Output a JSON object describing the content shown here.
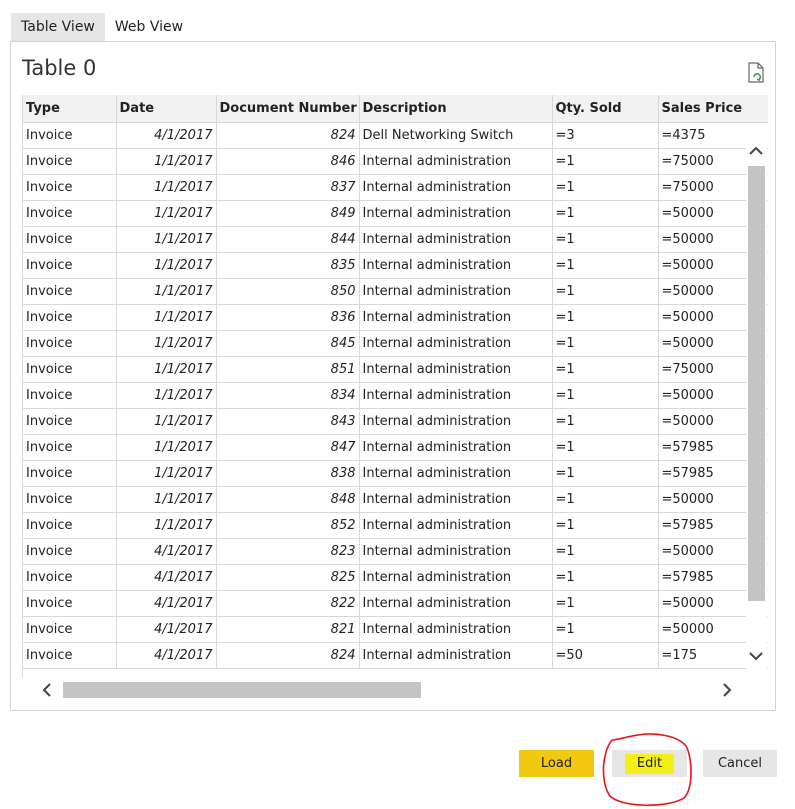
{
  "tabs": [
    "Table View",
    "Web View"
  ],
  "table_title": "Table 0",
  "columns": [
    "Type",
    "Date",
    "Document Number",
    "Description",
    "Qty. Sold",
    "Sales Price"
  ],
  "rows": [
    [
      "Invoice",
      "4/1/2017",
      "824",
      "Dell Networking Switch",
      "=3",
      "=4375"
    ],
    [
      "Invoice",
      "1/1/2017",
      "846",
      "Internal administration",
      "=1",
      "=75000"
    ],
    [
      "Invoice",
      "1/1/2017",
      "837",
      "Internal administration",
      "=1",
      "=75000"
    ],
    [
      "Invoice",
      "1/1/2017",
      "849",
      "Internal administration",
      "=1",
      "=50000"
    ],
    [
      "Invoice",
      "1/1/2017",
      "844",
      "Internal administration",
      "=1",
      "=50000"
    ],
    [
      "Invoice",
      "1/1/2017",
      "835",
      "Internal administration",
      "=1",
      "=50000"
    ],
    [
      "Invoice",
      "1/1/2017",
      "850",
      "Internal administration",
      "=1",
      "=50000"
    ],
    [
      "Invoice",
      "1/1/2017",
      "836",
      "Internal administration",
      "=1",
      "=50000"
    ],
    [
      "Invoice",
      "1/1/2017",
      "845",
      "Internal administration",
      "=1",
      "=50000"
    ],
    [
      "Invoice",
      "1/1/2017",
      "851",
      "Internal administration",
      "=1",
      "=75000"
    ],
    [
      "Invoice",
      "1/1/2017",
      "834",
      "Internal administration",
      "=1",
      "=50000"
    ],
    [
      "Invoice",
      "1/1/2017",
      "843",
      "Internal administration",
      "=1",
      "=50000"
    ],
    [
      "Invoice",
      "1/1/2017",
      "847",
      "Internal administration",
      "=1",
      "=57985"
    ],
    [
      "Invoice",
      "1/1/2017",
      "838",
      "Internal administration",
      "=1",
      "=57985"
    ],
    [
      "Invoice",
      "1/1/2017",
      "848",
      "Internal administration",
      "=1",
      "=50000"
    ],
    [
      "Invoice",
      "1/1/2017",
      "852",
      "Internal administration",
      "=1",
      "=57985"
    ],
    [
      "Invoice",
      "4/1/2017",
      "823",
      "Internal administration",
      "=1",
      "=50000"
    ],
    [
      "Invoice",
      "4/1/2017",
      "825",
      "Internal administration",
      "=1",
      "=57985"
    ],
    [
      "Invoice",
      "4/1/2017",
      "822",
      "Internal administration",
      "=1",
      "=50000"
    ],
    [
      "Invoice",
      "4/1/2017",
      "821",
      "Internal administration",
      "=1",
      "=50000"
    ],
    [
      "Invoice",
      "4/1/2017",
      "824",
      "Internal administration",
      "=50",
      "=175"
    ]
  ],
  "buttons": {
    "load": "Load",
    "edit": "Edit",
    "cancel": "Cancel"
  },
  "colors": {
    "load_button": "#f2c811",
    "edit_highlight": "#f4ef16",
    "annotation_circle": "#e8161a"
  },
  "icons": {
    "refresh": "document-refresh-icon",
    "scroll_up": "chevron-up-icon",
    "scroll_down": "chevron-down-icon",
    "scroll_left": "chevron-left-icon",
    "scroll_right": "chevron-right-icon"
  }
}
